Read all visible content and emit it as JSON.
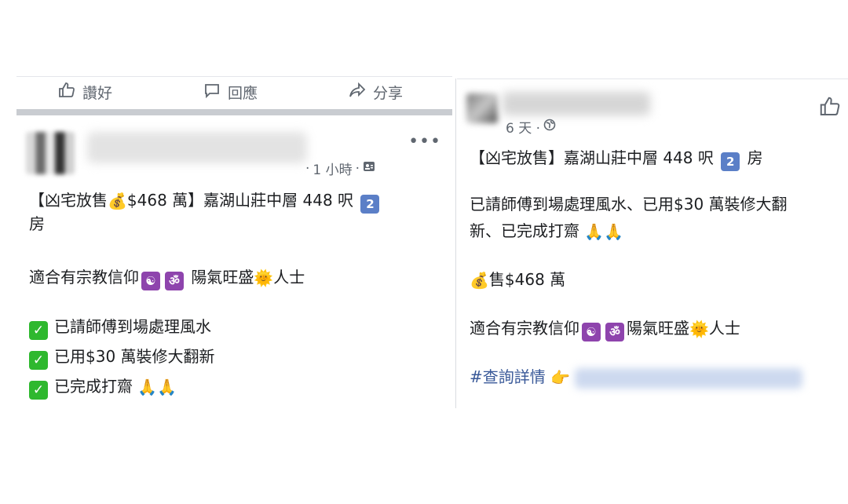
{
  "left_post": {
    "actions": {
      "like": "讚好",
      "comment": "回應",
      "share": "分享"
    },
    "time": "1 小時",
    "more": "•••",
    "title_part1": "【凶宅放售",
    "title_part2": "$468 萬】嘉湖山莊中層 448 呎",
    "title_badge": "2",
    "title_part3": "房",
    "line_religion_prefix": "適合有宗教信仰",
    "line_religion_suffix": "陽氣旺盛",
    "line_religion_end": "人士",
    "check1": "已請師傅到場處理風水",
    "check2": "已用$30 萬裝修大翻新",
    "check3": "已完成打齋"
  },
  "right_post": {
    "time": "6 天 ·",
    "title_part1": "【凶宅放售】嘉湖山莊中層 448 呎",
    "title_badge": "2",
    "title_part2": "房",
    "line2a": "已請師傅到場處理風水、已用$30 萬裝修大翻",
    "line2b": "新、已完成打齋",
    "price": "售$468 萬",
    "religion_prefix": "適合有宗教信仰",
    "religion_suffix": "陽氣旺盛",
    "religion_end": "人士",
    "hashtag": "#查詢詳情"
  }
}
